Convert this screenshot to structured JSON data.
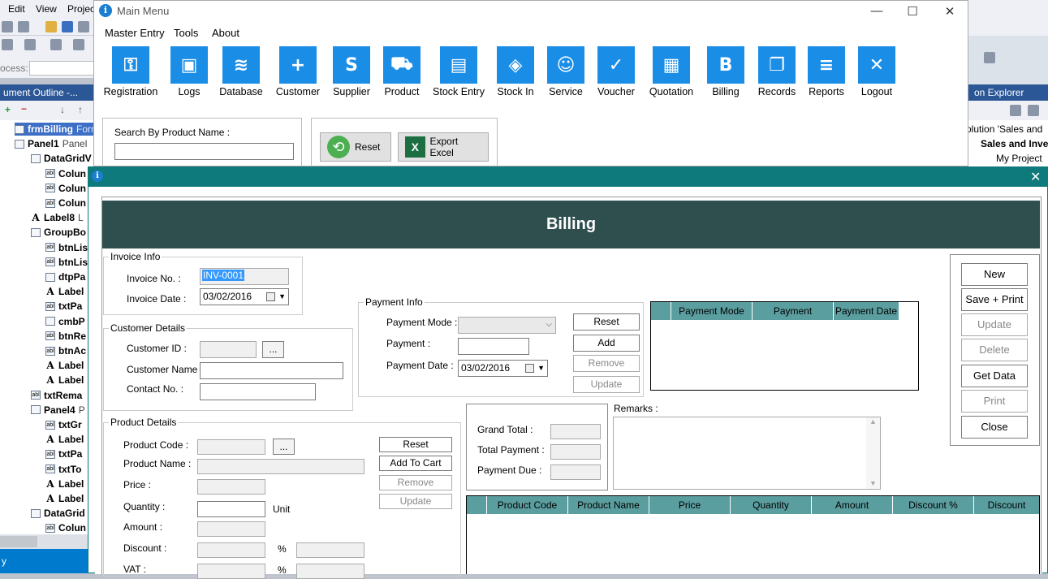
{
  "vs": {
    "menu": [
      "Edit",
      "View",
      "Project"
    ],
    "process_label": "ocess:",
    "outline_title": "ument Outline -...",
    "tree": [
      {
        "icon": "form",
        "name": "frmBilling",
        "type": "Form"
      },
      {
        "icon": "panel",
        "name": "Panel1",
        "type": "Panel"
      },
      {
        "icon": "grid",
        "name": "DataGridV",
        "type": ""
      },
      {
        "icon": "abl",
        "name": "Colun",
        "type": ""
      },
      {
        "icon": "abl",
        "name": "Colun",
        "type": ""
      },
      {
        "icon": "abl",
        "name": "Colun",
        "type": ""
      },
      {
        "icon": "A",
        "name": "Label8",
        "type": "L"
      },
      {
        "icon": "group",
        "name": "GroupBo",
        "type": ""
      },
      {
        "icon": "abl",
        "name": "btnLis",
        "type": ""
      },
      {
        "icon": "abl",
        "name": "btnLis",
        "type": ""
      },
      {
        "icon": "dtp",
        "name": "dtpPa",
        "type": ""
      },
      {
        "icon": "A",
        "name": "Label",
        "type": ""
      },
      {
        "icon": "abl",
        "name": "txtPa",
        "type": ""
      },
      {
        "icon": "combo",
        "name": "cmbP",
        "type": ""
      },
      {
        "icon": "abl",
        "name": "btnRe",
        "type": ""
      },
      {
        "icon": "abl",
        "name": "btnAc",
        "type": ""
      },
      {
        "icon": "A",
        "name": "Label",
        "type": ""
      },
      {
        "icon": "A",
        "name": "Label",
        "type": ""
      },
      {
        "icon": "abl",
        "name": "txtRema",
        "type": ""
      },
      {
        "icon": "panel",
        "name": "Panel4",
        "type": "P"
      },
      {
        "icon": "abl",
        "name": "txtGr",
        "type": ""
      },
      {
        "icon": "A",
        "name": "Label",
        "type": ""
      },
      {
        "icon": "abl",
        "name": "txtPa",
        "type": ""
      },
      {
        "icon": "abl",
        "name": "txtTo",
        "type": ""
      },
      {
        "icon": "A",
        "name": "Label",
        "type": ""
      },
      {
        "icon": "A",
        "name": "Label",
        "type": ""
      },
      {
        "icon": "grid",
        "name": "DataGrid",
        "type": ""
      },
      {
        "icon": "abl",
        "name": "Colun",
        "type": ""
      }
    ],
    "status": "y",
    "solution_explorer_title": "on Explorer",
    "solution_tree": [
      "olution 'Sales and",
      "Sales and Inver",
      "My Project"
    ]
  },
  "main_menu": {
    "title": "Main Menu",
    "menus": [
      "Master Entry",
      "Tools",
      "About"
    ],
    "tiles": [
      {
        "label": "Registration",
        "icon": "key-icon",
        "glyph": "⚿"
      },
      {
        "label": "Logs",
        "icon": "id-card-icon",
        "glyph": "▣"
      },
      {
        "label": "Database",
        "icon": "database-icon",
        "glyph": "≋"
      },
      {
        "label": "Customer",
        "icon": "add-user-icon",
        "glyph": "+"
      },
      {
        "label": "Supplier",
        "icon": "supplier-icon",
        "glyph": "S"
      },
      {
        "label": "Product",
        "icon": "cart-icon",
        "glyph": "⛟"
      },
      {
        "label": "Stock Entry",
        "icon": "archive-icon",
        "glyph": "▤"
      },
      {
        "label": "Stock In",
        "icon": "tag-icon",
        "glyph": "◈"
      },
      {
        "label": "Service",
        "icon": "smiley-icon",
        "glyph": "☺"
      },
      {
        "label": "Voucher",
        "icon": "checklist-icon",
        "glyph": "✓"
      },
      {
        "label": "Quotation",
        "icon": "document-icon",
        "glyph": "▦"
      },
      {
        "label": "Billing",
        "icon": "billing-icon",
        "glyph": "B"
      },
      {
        "label": "Records",
        "icon": "book-icon",
        "glyph": "❐"
      },
      {
        "label": "Reports",
        "icon": "report-icon",
        "glyph": "≡"
      },
      {
        "label": "Logout",
        "icon": "close-icon",
        "glyph": "✕"
      }
    ],
    "search_label": "Search By Product Name :",
    "search_value": "",
    "reset_label": "Reset",
    "export_label": "Export Excel"
  },
  "billing": {
    "header": "Billing",
    "invoice_info": {
      "title": "Invoice Info",
      "invoice_no_label": "Invoice No. :",
      "invoice_no": "INV-0001",
      "invoice_date_label": "Invoice Date :",
      "invoice_date": "03/02/2016"
    },
    "customer_details": {
      "title": "Customer Details",
      "customer_id_label": "Customer ID :",
      "customer_name_label": "Customer Name :",
      "contact_label": "Contact No. :",
      "browse_label": "..."
    },
    "payment_info": {
      "title": "Payment Info",
      "mode_label": "Payment Mode :",
      "payment_label": "Payment :",
      "date_label": "Payment Date :",
      "date_value": "03/02/2016",
      "reset": "Reset",
      "add": "Add",
      "remove": "Remove",
      "update": "Update"
    },
    "payment_grid_columns": [
      "",
      "Payment Mode",
      "Payment",
      "Payment Date"
    ],
    "actions": [
      "New",
      "Save + Print",
      "Update",
      "Delete",
      "Get Data",
      "Print",
      "Close"
    ],
    "product_details": {
      "title": "Product Details",
      "code_label": "Product Code :",
      "name_label": "Product Name :",
      "price_label": "Price :",
      "quantity_label": "Quantity :",
      "unit_label": "Unit",
      "amount_label": "Amount :",
      "discount_label": "Discount :",
      "vat_label": "VAT :",
      "percent": "%",
      "browse_label": "...",
      "reset": "Reset",
      "add_to_cart": "Add To Cart",
      "remove": "Remove",
      "update": "Update"
    },
    "totals": {
      "grand_total_label": "Grand Total :",
      "total_payment_label": "Total Payment :",
      "payment_due_label": "Payment Due :"
    },
    "remarks_label": "Remarks :",
    "product_grid_columns": [
      "",
      "Product Code",
      "Product Name",
      "Price",
      "Quantity",
      "Amount",
      "Discount %",
      "Discount"
    ]
  },
  "colors": {
    "header_bg": "#2f4f4f",
    "grid_header": "#5b9ea0",
    "tile_blue": "#1a8de6",
    "window_teal": "#0e7a7c"
  }
}
